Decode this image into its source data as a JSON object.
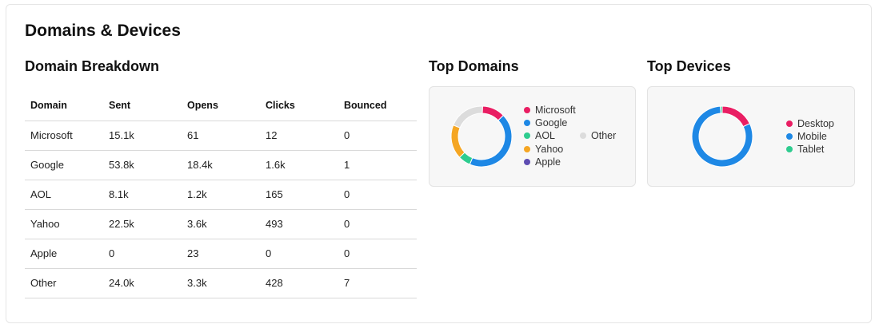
{
  "card": {
    "title": "Domains & Devices"
  },
  "breakdown": {
    "title": "Domain Breakdown",
    "columns": [
      "Domain",
      "Sent",
      "Opens",
      "Clicks",
      "Bounced"
    ],
    "rows": [
      [
        "Microsoft",
        "15.1k",
        "61",
        "12",
        "0"
      ],
      [
        "Google",
        "53.8k",
        "18.4k",
        "1.6k",
        "1"
      ],
      [
        "AOL",
        "8.1k",
        "1.2k",
        "165",
        "0"
      ],
      [
        "Yahoo",
        "22.5k",
        "3.6k",
        "493",
        "0"
      ],
      [
        "Apple",
        "0",
        "23",
        "0",
        "0"
      ],
      [
        "Other",
        "24.0k",
        "3.3k",
        "428",
        "7"
      ]
    ]
  },
  "top_domains": {
    "title": "Top Domains",
    "legend": [
      {
        "label": "Microsoft",
        "color": "#e91e63"
      },
      {
        "label": "Google",
        "color": "#1e88e5"
      },
      {
        "label": "AOL",
        "color": "#2ecc8f"
      },
      {
        "label": "Yahoo",
        "color": "#f5a623"
      },
      {
        "label": "Apple",
        "color": "#5e4db2"
      },
      {
        "label": "Other",
        "color": "#dcdcdc"
      }
    ],
    "slices": [
      {
        "label": "Microsoft",
        "value": 15.1,
        "color": "#e91e63"
      },
      {
        "label": "Google",
        "value": 53.8,
        "color": "#1e88e5"
      },
      {
        "label": "AOL",
        "value": 8.1,
        "color": "#2ecc8f"
      },
      {
        "label": "Yahoo",
        "value": 22.5,
        "color": "#f5a623"
      },
      {
        "label": "Apple",
        "value": 0,
        "color": "#5e4db2"
      },
      {
        "label": "Other",
        "value": 24.0,
        "color": "#dcdcdc"
      }
    ]
  },
  "top_devices": {
    "title": "Top Devices",
    "legend": [
      {
        "label": "Desktop",
        "color": "#e91e63"
      },
      {
        "label": "Mobile",
        "color": "#1e88e5"
      },
      {
        "label": "Tablet",
        "color": "#2ecc8f"
      }
    ],
    "slices": [
      {
        "label": "Desktop",
        "value": 18,
        "color": "#e91e63"
      },
      {
        "label": "Mobile",
        "value": 81,
        "color": "#1e88e5"
      },
      {
        "label": "Tablet",
        "value": 1,
        "color": "#2ecc8f"
      }
    ]
  }
}
